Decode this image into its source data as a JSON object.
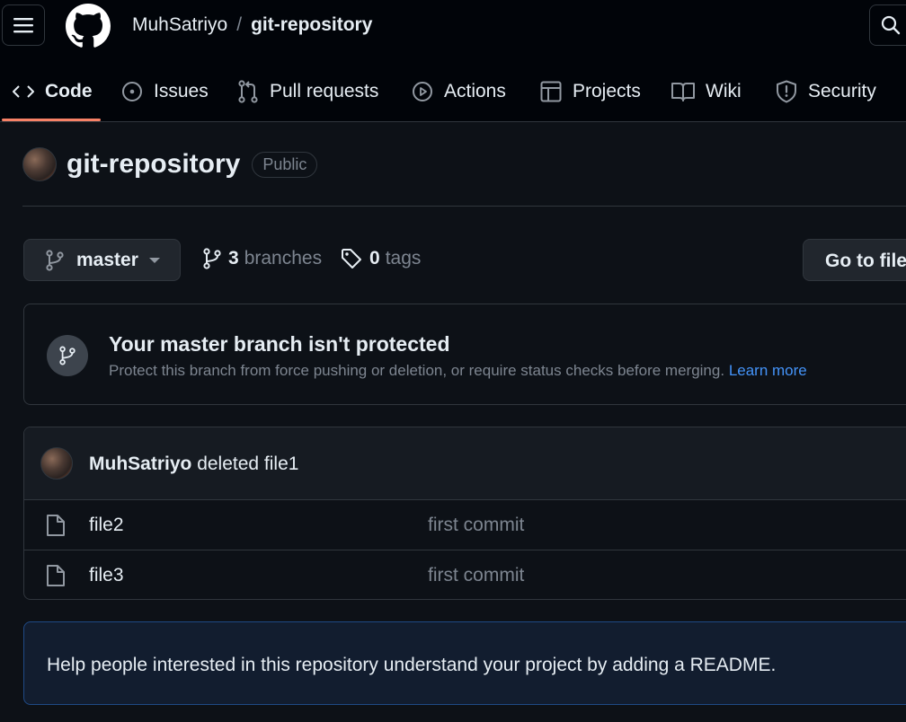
{
  "header": {
    "owner": "MuhSatriyo",
    "separator": "/",
    "repo": "git-repository"
  },
  "tabs": [
    {
      "label": "Code",
      "icon": "code-icon",
      "active": true
    },
    {
      "label": "Issues",
      "icon": "issue-opened-icon"
    },
    {
      "label": "Pull requests",
      "icon": "git-pull-request-icon"
    },
    {
      "label": "Actions",
      "icon": "play-icon"
    },
    {
      "label": "Projects",
      "icon": "table-icon"
    },
    {
      "label": "Wiki",
      "icon": "book-icon"
    },
    {
      "label": "Security",
      "icon": "shield-icon"
    }
  ],
  "repo": {
    "title": "git-repository",
    "visibility": "Public"
  },
  "toolbar": {
    "branch": "master",
    "branches_count": "3",
    "branches_label": "branches",
    "tags_count": "0",
    "tags_label": "tags",
    "goto_file": "Go to file"
  },
  "protection": {
    "title": "Your master branch isn't protected",
    "description": "Protect this branch from force pushing or deletion, or require status checks before merging.",
    "link": "Learn more"
  },
  "latest_commit": {
    "author": "MuhSatriyo",
    "message": "deleted file1"
  },
  "files": [
    {
      "name": "file2",
      "commit": "first commit"
    },
    {
      "name": "file3",
      "commit": "first commit"
    }
  ],
  "readme_prompt": "Help people interested in this repository understand your project by adding a README.",
  "colors": {
    "background": "#0d1117",
    "header": "#010409",
    "active_tab_underline": "#f78166",
    "link": "#4493f8"
  }
}
